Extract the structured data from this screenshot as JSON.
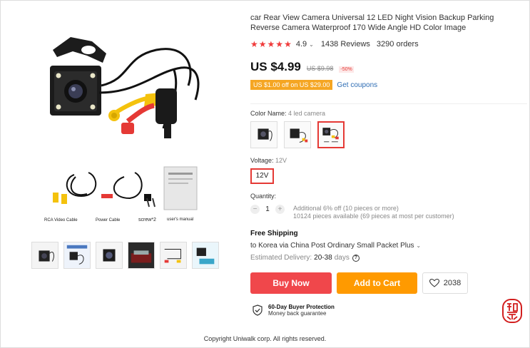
{
  "product": {
    "title": "car Rear View Camera Universal 12 LED Night Vision Backup Parking Reverse Camera Waterproof 170 Wide Angle HD Color Image",
    "rating": "4.9",
    "reviews": "1438 Reviews",
    "orders": "3290 orders",
    "price": "US $4.99",
    "old_price": "US $9.98",
    "discount": "-50%",
    "coupon": "US $1.00 off on US $29.00",
    "get_coupons": "Get coupons"
  },
  "gallery": {
    "labels": {
      "rca": "RCA Video Cable",
      "power": "Power Cable",
      "screw": "screw*2",
      "manual": "user's manual"
    },
    "thumbnails": [
      "camera",
      "camera-set",
      "camera-closeup",
      "car-rear",
      "cables",
      "camera-install"
    ]
  },
  "color": {
    "label": "Color Name:",
    "value": "4 led camera",
    "options": [
      "Camera only",
      "Camera with wires",
      "4 led camera"
    ]
  },
  "voltage": {
    "label": "Voltage:",
    "value": "12V",
    "option": "12V"
  },
  "quantity": {
    "label": "Quantity:",
    "minus": "−",
    "plus": "+",
    "value": "1",
    "info1": "Additional 6% off (10 pieces or more)",
    "info2": "10124 pieces available (69 pieces at most per customer)"
  },
  "shipping": {
    "title": "Free Shipping",
    "line": "to Korea via China Post Ordinary Small Packet Plus",
    "est_label": "Estimated Delivery:",
    "days": "20-38",
    "days_word": "days",
    "help": "?"
  },
  "actions": {
    "buy": "Buy Now",
    "cart": "Add to Cart",
    "wish_count": "2038"
  },
  "protection": {
    "title": "60-Day Buyer Protection",
    "subtitle": "Money back guarantee"
  },
  "footer": {
    "copyright": "Copyright Uniwalk corp. All rights reserved."
  },
  "colors": {
    "accent_red": "#f0474b",
    "accent_orange": "#ff9a00",
    "link_blue": "#2e6db4",
    "star_red": "#f03b3b"
  },
  "icons": [
    "chevron-down-icon",
    "heart-icon",
    "shield-check-icon",
    "question-icon",
    "seal-stamp-icon"
  ]
}
